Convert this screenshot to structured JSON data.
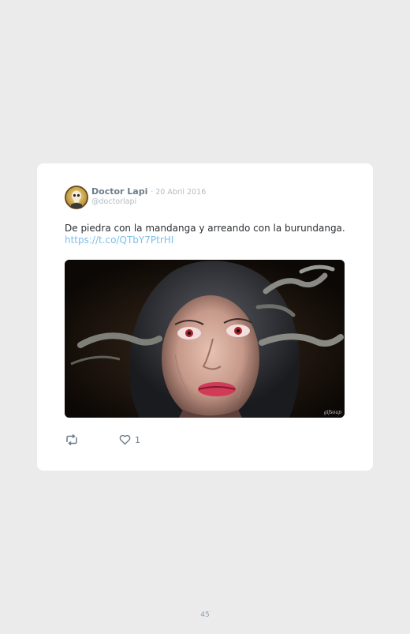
{
  "tweet": {
    "author_name": "Doctor Lapi",
    "date": "· 20 Abril 2016",
    "handle": "@doctorlapi",
    "text": "De piedra con la mandanga y arreando con la burundanga.",
    "link": "https://t.co/QTbY7PtrHI",
    "media_watermark": "gifsoup",
    "like_count": "1"
  },
  "icons": {
    "retweet": "retweet-icon",
    "like": "heart-icon",
    "avatar": "avatar-skull"
  },
  "colors": {
    "link": "#7cc0e6",
    "name": "#6c7c8a",
    "meta": "#b3bcc4",
    "background": "#ebebeb"
  },
  "page": {
    "number": "45"
  }
}
